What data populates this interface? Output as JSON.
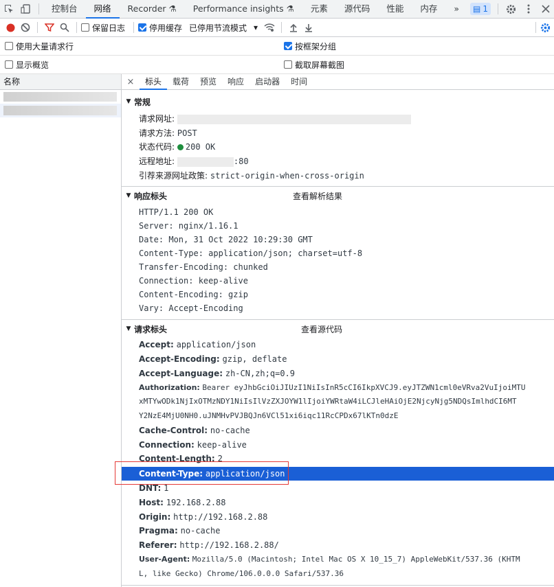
{
  "tabbar": {
    "tabs": [
      "控制台",
      "网络",
      "Recorder",
      "Performance insights",
      "元素",
      "源代码",
      "性能",
      "内存"
    ],
    "more": "»",
    "badge_count": "1"
  },
  "toolbar": {
    "preserve_log": "保留日志",
    "disable_cache": "停用缓存",
    "throttle": "已停用节流模式",
    "throttle_arrow": "▾"
  },
  "options": {
    "large_rows": "使用大量请求行",
    "group_by_frame": "按框架分组",
    "show_overview": "显示概览",
    "capture_screenshots": "截取屏幕截图"
  },
  "left": {
    "header": "名称"
  },
  "detail_tabs": [
    "标头",
    "载荷",
    "预览",
    "响应",
    "启动器",
    "时间"
  ],
  "general": {
    "title": "常规",
    "url_label": "请求网址:",
    "method_label": "请求方法:",
    "method": "POST",
    "status_label": "状态代码:",
    "status": "200 OK",
    "remote_label": "远程地址:",
    "remote_port": ":80",
    "referrer_label": "引荐来源网址政策:",
    "referrer": "strict-origin-when-cross-origin"
  },
  "response_headers": {
    "title": "响应标头",
    "view_parsed": "查看解析结果",
    "lines": [
      "HTTP/1.1 200 OK",
      "Server: nginx/1.16.1",
      "Date: Mon, 31 Oct 2022 10:29:30 GMT",
      "Content-Type: application/json; charset=utf-8",
      "Transfer-Encoding: chunked",
      "Connection: keep-alive",
      "Content-Encoding: gzip",
      "Vary: Accept-Encoding"
    ]
  },
  "request_headers": {
    "title": "请求标头",
    "view_source": "查看源代码",
    "accept": {
      "name": "Accept:",
      "value": "application/json"
    },
    "accept_encoding": {
      "name": "Accept-Encoding:",
      "value": "gzip, deflate"
    },
    "accept_language": {
      "name": "Accept-Language:",
      "value": "zh-CN,zh;q=0.9"
    },
    "authorization": {
      "name": "Authorization:",
      "value1": "Bearer eyJhbGciOiJIUzI1NiIsInR5cCI6IkpXVCJ9.eyJTZWN1cml0eVRva2VuIjoiMTU",
      "value2": "xMTYwODk1NjIxOTMzNDY1NiIsIlVzZXJOYW1lIjoiYWRtaW4iLCJleHAiOjE2NjcyNjg5NDQsImlhdCI6MT",
      "value3": "Y2NzE4MjU0NH0.uJNMHvPVJBQJn6VCl51xi6iqc11RcCPDx67lKTn0dzE"
    },
    "cache_control": {
      "name": "Cache-Control:",
      "value": "no-cache"
    },
    "connection": {
      "name": "Connection:",
      "value": "keep-alive"
    },
    "content_length": {
      "name": "Content-Length:",
      "value": "2"
    },
    "content_type": {
      "name": "Content-Type:",
      "value": "application/json"
    },
    "dnt": {
      "name": "DNT:",
      "value": "1"
    },
    "host": {
      "name": "Host:",
      "value": "192.168.2.88"
    },
    "origin": {
      "name": "Origin:",
      "value": "http://192.168.2.88"
    },
    "pragma": {
      "name": "Pragma:",
      "value": "no-cache"
    },
    "referer": {
      "name": "Referer:",
      "value": "http://192.168.2.88/"
    },
    "user_agent": {
      "name": "User-Agent:",
      "value1": "Mozilla/5.0 (Macintosh; Intel Mac OS X 10_15_7) AppleWebKit/537.36 (KHTM",
      "value2": "L, like Gecko) Chrome/106.0.0.0 Safari/537.36"
    }
  },
  "colors": {
    "accent": "#1a73e8",
    "selected": "#1a5fd6",
    "highlight_box": "#e53935",
    "record": "#d93025"
  }
}
